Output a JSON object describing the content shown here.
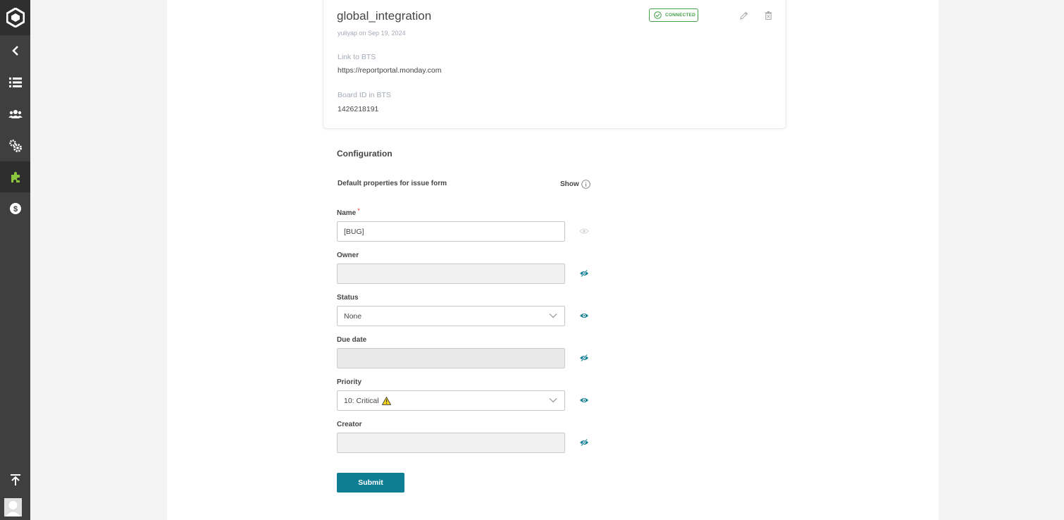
{
  "sidebar": {
    "items": [
      {
        "icon": "logo-icon"
      },
      {
        "icon": "chevron-left-icon"
      },
      {
        "icon": "list-icon"
      },
      {
        "icon": "members-icon"
      },
      {
        "icon": "settings-icon"
      },
      {
        "icon": "plugin-icon",
        "active": true
      },
      {
        "icon": "dollar-icon"
      },
      {
        "icon": "scroll-top-icon"
      },
      {
        "icon": "avatar"
      }
    ]
  },
  "integration": {
    "title": "global_integration",
    "subtitle": "yuliyap on Sep 19, 2024",
    "status": "CONNECTED",
    "link_label": "Link to BTS",
    "link_value": "https://reportportal.monday.com",
    "board_label": "Board ID in BTS",
    "board_value": "1426218191"
  },
  "config": {
    "title": "Configuration",
    "default_props": "Default properties for issue form",
    "show_label": "Show",
    "fields": {
      "name": {
        "label": "Name",
        "required_mark": "*",
        "value": "[BUG]",
        "visible": false
      },
      "owner": {
        "label": "Owner",
        "value": "",
        "visible": false
      },
      "status": {
        "label": "Status",
        "value": "None",
        "visible": true
      },
      "due_date": {
        "label": "Due date",
        "value": "",
        "visible": false
      },
      "priority": {
        "label": "Priority",
        "value": "10: Critical",
        "visible": true
      },
      "creator": {
        "label": "Creator",
        "value": "",
        "visible": false
      }
    },
    "submit_label": "Submit"
  },
  "colors": {
    "accent": "#0e7e94",
    "connected": "#43a047",
    "sidebar": "#3f3f3f",
    "plugin_active": "#8cc63f"
  }
}
